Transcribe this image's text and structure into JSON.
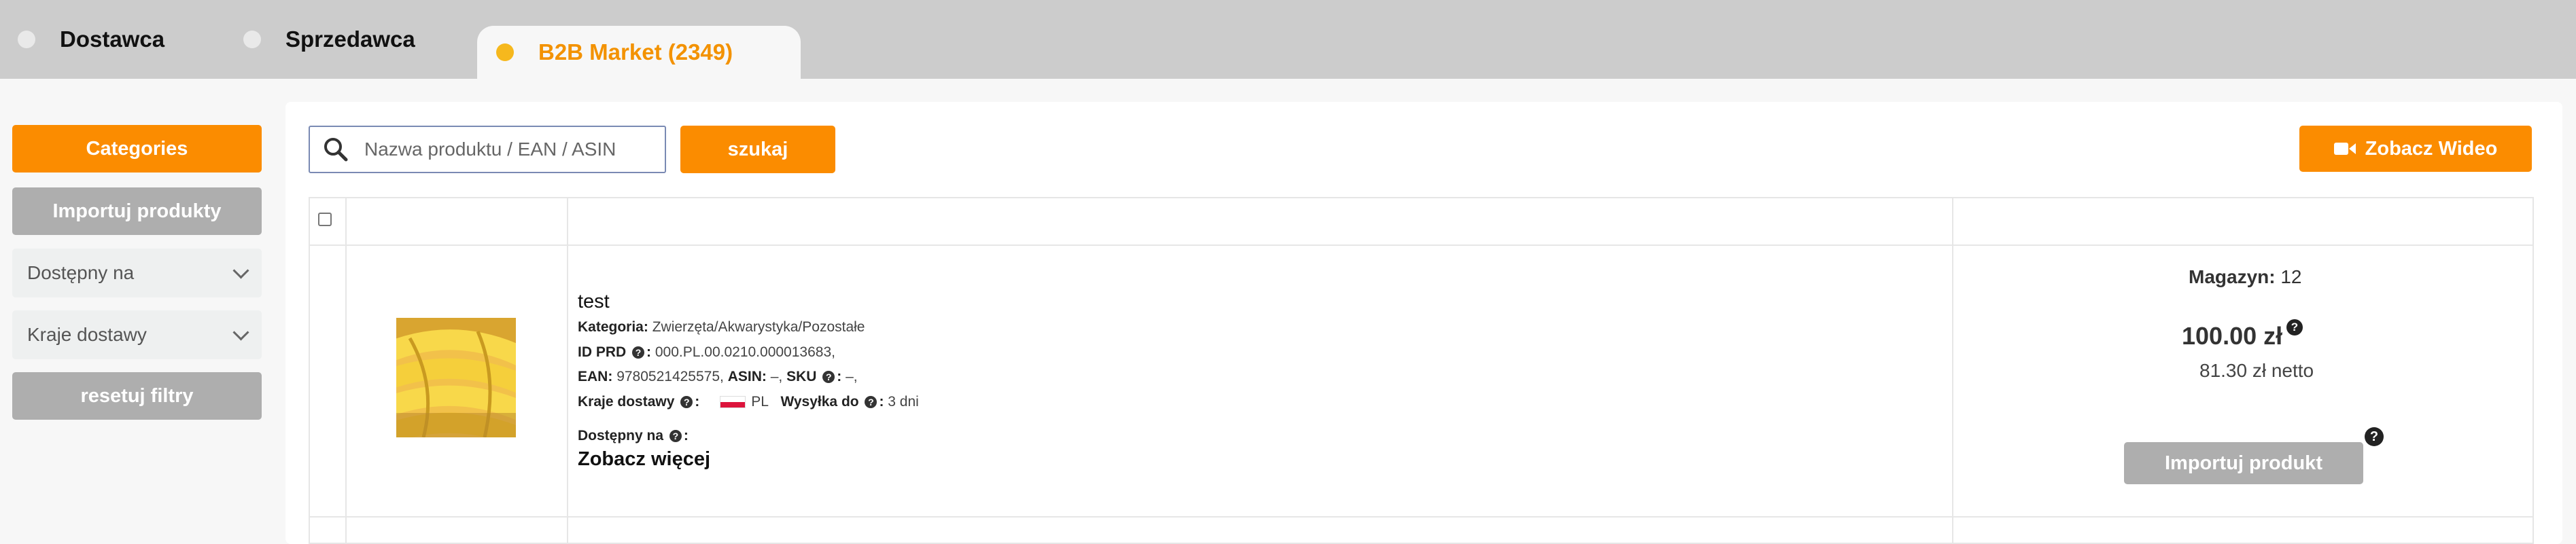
{
  "tabs": [
    {
      "label": "Dostawca"
    },
    {
      "label": "Sprzedawca"
    },
    {
      "label": "B2B Market (2349)",
      "active": true
    }
  ],
  "sidebar": {
    "categories_label": "Categories",
    "import_products_label": "Importuj produkty",
    "available_on_select": "Dostępny na",
    "delivery_countries_select": "Kraje dostawy",
    "reset_filters_label": "resetuj filtry"
  },
  "search": {
    "placeholder": "Nazwa produktu / EAN / ASIN",
    "button_label": "szukaj",
    "icon": "search-icon"
  },
  "video_button": {
    "label": "Zobacz Wideo",
    "icon": "video-camera-icon"
  },
  "product": {
    "title": "test",
    "category_label": "Kategoria:",
    "category_value": "Zwierzęta/Akwarystyka/Pozostałe",
    "id_label": "ID PRD",
    "id_value": "000.PL.00.0210.000013683,",
    "ean_label": "EAN:",
    "ean_value": "9780521425575,",
    "asin_label": "ASIN:",
    "asin_value": "–,",
    "sku_label": "SKU",
    "sku_value": "–,",
    "countries_label": "Kraje dostawy",
    "country_code": "PL",
    "shipping_label": "Wysyłka do",
    "shipping_value": "3 dni",
    "available_on_label": "Dostępny na",
    "see_more_label": "Zobacz więcej",
    "stock_label": "Magazyn:",
    "stock_value": "12",
    "price": "100.00 zł",
    "price_net": "81.30 zł netto",
    "import_label": "Importuj produkt"
  },
  "colors": {
    "accent": "#fb8c00",
    "tab_active_text": "#f39200",
    "tab_active_dot": "#f6b81d",
    "disabled_button": "#aeaeae"
  }
}
